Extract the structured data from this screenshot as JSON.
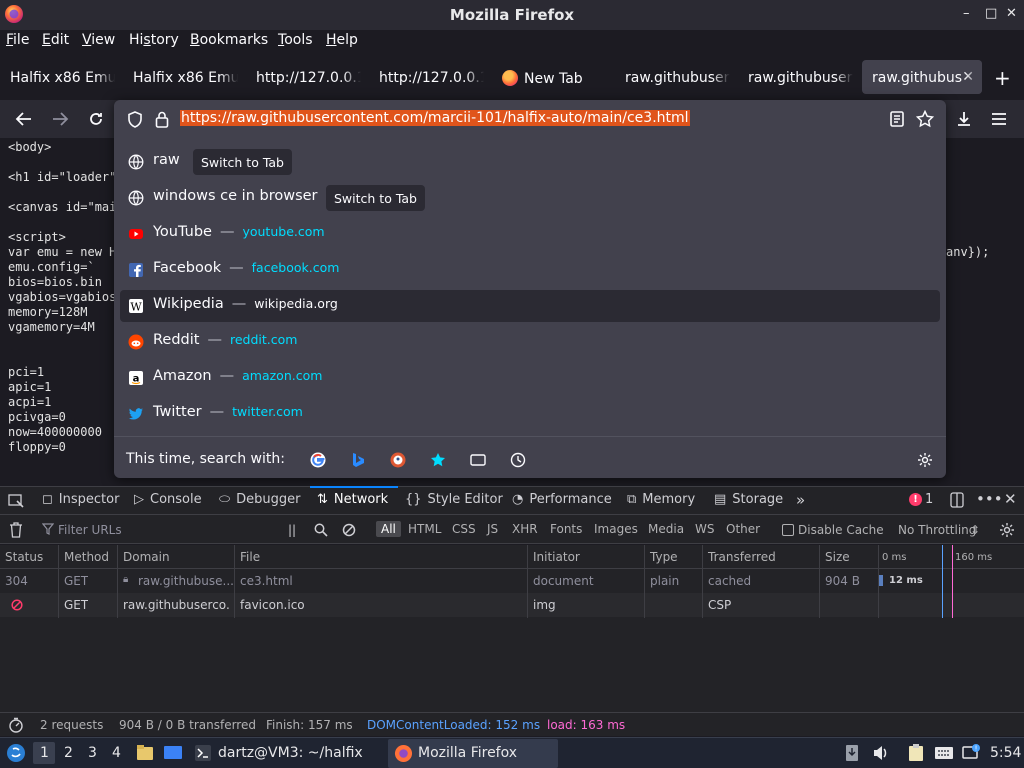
{
  "window": {
    "title": "Mozilla Firefox",
    "controls": [
      "–",
      "□",
      "✕"
    ]
  },
  "menu": {
    "items": [
      {
        "pre": "",
        "u": "F",
        "post": "ile"
      },
      {
        "pre": "",
        "u": "E",
        "post": "dit"
      },
      {
        "pre": "",
        "u": "V",
        "post": "iew"
      },
      {
        "pre": "Hi",
        "u": "s",
        "post": "tory"
      },
      {
        "pre": "",
        "u": "B",
        "post": "ookmarks"
      },
      {
        "pre": "",
        "u": "T",
        "post": "ools"
      },
      {
        "pre": "",
        "u": "H",
        "post": "elp"
      }
    ]
  },
  "tabs": [
    {
      "label": "Halfix x86 Emu"
    },
    {
      "label": "Halfix x86 Emu"
    },
    {
      "label": "http://127.0.0.1"
    },
    {
      "label": "http://127.0.0.1"
    },
    {
      "label": "New Tab"
    },
    {
      "label": "raw.githubuser"
    },
    {
      "label": "raw.githubuser"
    },
    {
      "label": "raw.githubus"
    }
  ],
  "urlbar": {
    "url": "https://raw.githubusercontent.com/marcii-101/halfix-auto/main/ce3.html",
    "suggestions": [
      {
        "title": "raw",
        "badge": "Switch to Tab",
        "icon": "globe-icon"
      },
      {
        "title": "windows ce in browser",
        "badge": "Switch to Tab",
        "icon": "globe-icon"
      },
      {
        "title": "YouTube",
        "sep": "—",
        "url": "youtube.com",
        "icon": "youtube-icon"
      },
      {
        "title": "Facebook",
        "sep": "—",
        "url": "facebook.com",
        "icon": "facebook-icon"
      },
      {
        "title": "Wikipedia",
        "sep": "—",
        "url": "wikipedia.org",
        "icon": "wikipedia-icon"
      },
      {
        "title": "Reddit",
        "sep": "—",
        "url": "reddit.com",
        "icon": "reddit-icon"
      },
      {
        "title": "Amazon",
        "sep": "—",
        "url": "amazon.com",
        "icon": "amazon-icon"
      },
      {
        "title": "Twitter",
        "sep": "—",
        "url": "twitter.com",
        "icon": "twitter-icon"
      }
    ],
    "search_with_label": "This time, search with:"
  },
  "page_source": {
    "lines": [
      "<body>",
      "",
      "<h1 id=\"loader\"",
      "",
      "<canvas id=\"mai",
      "",
      "<script>",
      "var emu = new H",
      "emu.config=`",
      "bios=bios.bin",
      "vgabios=vgabios",
      "memory=128M",
      "vgamemory=4M",
      "",
      "",
      "pci=1",
      "apic=1",
      "acpi=1",
      "pcivga=0",
      "now=400000000",
      "floppy=0"
    ],
    "right_fragment": "anv});"
  },
  "devtools": {
    "tabs": [
      "Inspector",
      "Console",
      "Debugger",
      "Network",
      "Style Editor",
      "Performance",
      "Memory",
      "Storage"
    ],
    "error_count": "1",
    "filter_placeholder": "Filter URLs",
    "type_filters": [
      "All",
      "HTML",
      "CSS",
      "JS",
      "XHR",
      "Fonts",
      "Images",
      "Media",
      "WS",
      "Other"
    ],
    "disable_cache": "Disable Cache",
    "throttling": "No Throttling",
    "columns": [
      "Status",
      "Method",
      "Domain",
      "File",
      "Initiator",
      "Type",
      "Transferred",
      "Size"
    ],
    "timeline_ticks": [
      "0 ms",
      "160 ms"
    ],
    "requests": [
      {
        "status": "304",
        "method": "GET",
        "domain": "raw.githubuse...",
        "file": "ce3.html",
        "initiator": "document",
        "type": "plain",
        "transferred": "cached",
        "size": "904 B",
        "time": "12 ms"
      },
      {
        "status": "",
        "method": "GET",
        "domain": "raw.githubuserco...",
        "file": "favicon.ico",
        "initiator": "img",
        "type": "",
        "transferred": "CSP",
        "size": "",
        "time": ""
      }
    ],
    "summary": {
      "requests": "2 requests",
      "transferred": "904 B / 0 B transferred",
      "finish": "Finish: 157 ms",
      "dcl": "DOMContentLoaded: 152 ms",
      "load": "load: 163 ms"
    }
  },
  "taskbar": {
    "workspaces": [
      "1",
      "2",
      "3",
      "4"
    ],
    "terminal": "dartz@VM3: ~/halfix",
    "browser": "Mozilla Firefox",
    "clock": "5:54"
  },
  "colors": {
    "accent": "#0a84ff",
    "url_highlight": "#e0541b",
    "link": "#00ddff",
    "dcl": "#5aa2ff",
    "load": "#ff6ad5",
    "error": "#ff3b6b"
  }
}
